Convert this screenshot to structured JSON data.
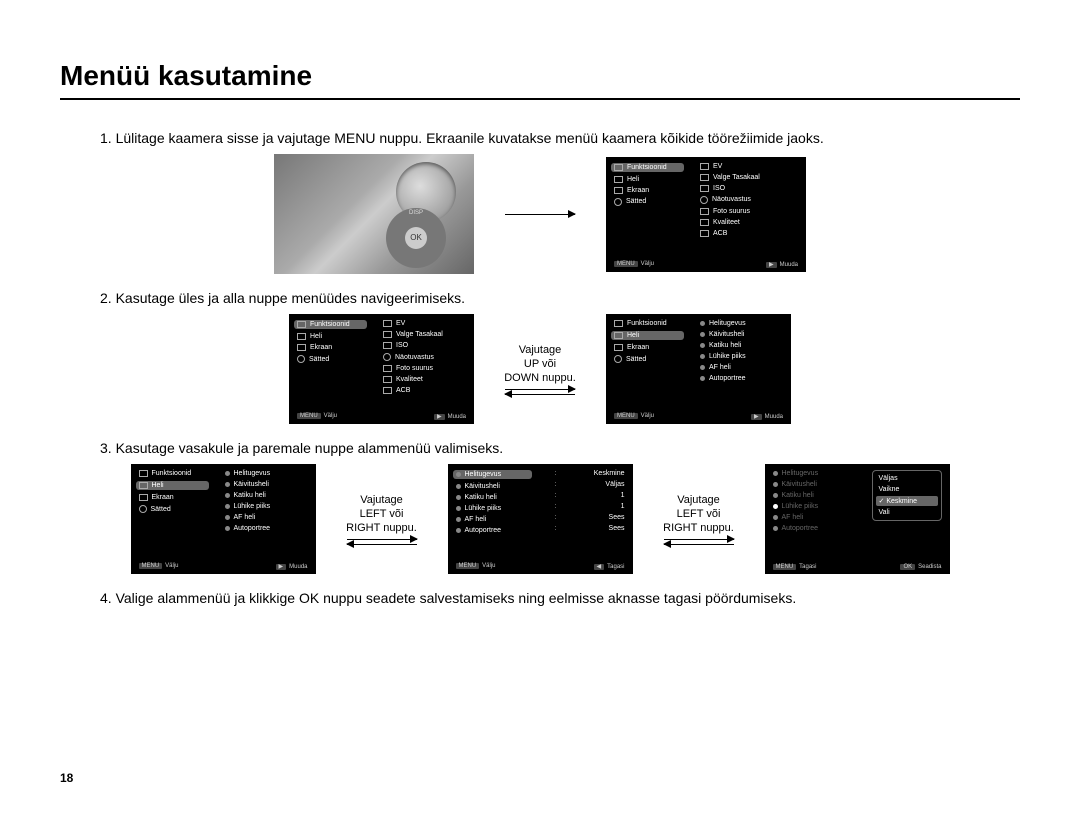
{
  "title": "Menüü kasutamine",
  "pageNumber": "18",
  "steps": {
    "s1": "1. Lülitage kaamera sisse ja vajutage MENU nuppu. Ekraanile kuvatakse menüü kaamera kõikide töörežiimide jaoks.",
    "s2": "2. Kasutage üles ja alla nuppe menüüdes navigeerimiseks.",
    "s3": "3. Kasutage vasakule ja paremale nuppe alammenüü valimiseks.",
    "s4": "4. Valige alammenüü ja klikkige OK nuppu seadete salvestamiseks ning eelmisse aknasse tagasi pöördumiseks."
  },
  "arrowLabels": {
    "upDown": "Vajutage\nUP või\nDOWN nuppu.",
    "leftRight": "Vajutage\nLEFT või\nRIGHT nuppu."
  },
  "menu": {
    "tabs": {
      "funktsioonid": "Funktsioonid",
      "heli": "Heli",
      "ekraan": "Ekraan",
      "satted": "Sätted"
    },
    "funcItems": {
      "ev": "EV",
      "valgeTasakaal": "Valge Tasakaal",
      "iso": "ISO",
      "naotuvastus": "Näotuvastus",
      "fotoSuurus": "Foto suurus",
      "kvaliteet": "Kvaliteet",
      "acb": "ACB"
    },
    "heliItems": {
      "helitugevus": "Helitugevus",
      "kaivitusheli": "Käivitusheli",
      "katikuHeli": "Katiku heli",
      "luhikePiiks": "Lühike piiks",
      "afHeli": "AF heli",
      "autoportree": "Autoportree"
    },
    "heliValues": {
      "helitugevus": "Keskmine",
      "kaivitusheli": "Väljas",
      "katikuHeli": "1",
      "luhikePiiks": "1",
      "afHeli": "Sees",
      "autoportree": "Sees"
    },
    "volumeOptions": {
      "valjas": "Väljas",
      "vaikne": "Vaikne",
      "keskmine": "Keskmine",
      "vali": "Vali"
    },
    "footer": {
      "menu": "MENU",
      "valju": "Välju",
      "muuda": "Muuda",
      "tagasi": "Tagasi",
      "ok": "OK",
      "seadista": "Seadista"
    }
  },
  "cameraButtons": {
    "ok": "OK",
    "disp": "DISP"
  }
}
